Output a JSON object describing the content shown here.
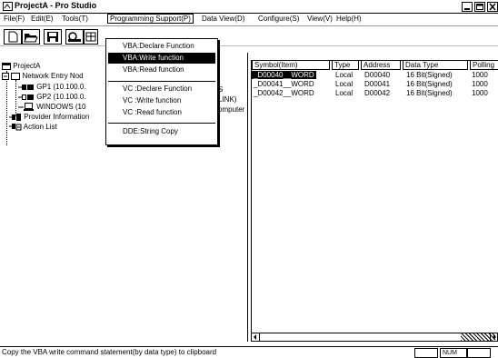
{
  "window": {
    "title": "ProjectA - Pro Studio"
  },
  "menubar": {
    "items": [
      {
        "label": "File(F)"
      },
      {
        "label": "Edit(E)"
      },
      {
        "label": "Tools(T)"
      },
      {
        "label": "Programming Support(P)"
      },
      {
        "label": "Data View(D)"
      },
      {
        "label": "Configure(S)"
      },
      {
        "label": "View(V)"
      },
      {
        "label": "Help(H)"
      }
    ]
  },
  "dropdown": {
    "items": [
      {
        "label": "VBA:Declare Function"
      },
      {
        "label": "VBA:Write function",
        "selected": true
      },
      {
        "label": "VBA:Read function"
      },
      {
        "label": "VC :Declare Function"
      },
      {
        "label": "VC :Write function"
      },
      {
        "label": "VC :Read function"
      },
      {
        "label": "DDE:String Copy"
      }
    ]
  },
  "tree": {
    "root": "ProjectA",
    "network": "Network Entry Nod",
    "nodes": [
      {
        "label": "GP1 (10.100.0."
      },
      {
        "label": "GP2 (10.100.0."
      },
      {
        "label": "WINDOWS (10"
      }
    ],
    "provider": "Provider Information",
    "action": "Action List",
    "truncated": [
      "S",
      "LINK)",
      "omputer"
    ]
  },
  "list": {
    "columns": [
      "Symbol(Item)",
      "Type",
      "Address",
      "Data Type",
      "Polling"
    ],
    "rows": [
      {
        "symbol": "_D00040__WORD",
        "type": "Local",
        "address": "D00040",
        "data_type": "16 Bit(Signed)",
        "polling": "1000",
        "selected": true
      },
      {
        "symbol": "_D00041__WORD",
        "type": "Local",
        "address": "D00041",
        "data_type": "16 Bit(Signed)",
        "polling": "1000"
      },
      {
        "symbol": "_D00042__WORD",
        "type": "Local",
        "address": "D00042",
        "data_type": "16 Bit(Signed)",
        "polling": "1000"
      }
    ]
  },
  "statusbar": {
    "text": "Copy the VBA write command statement(by data type) to clipboard",
    "num": "NUM"
  }
}
